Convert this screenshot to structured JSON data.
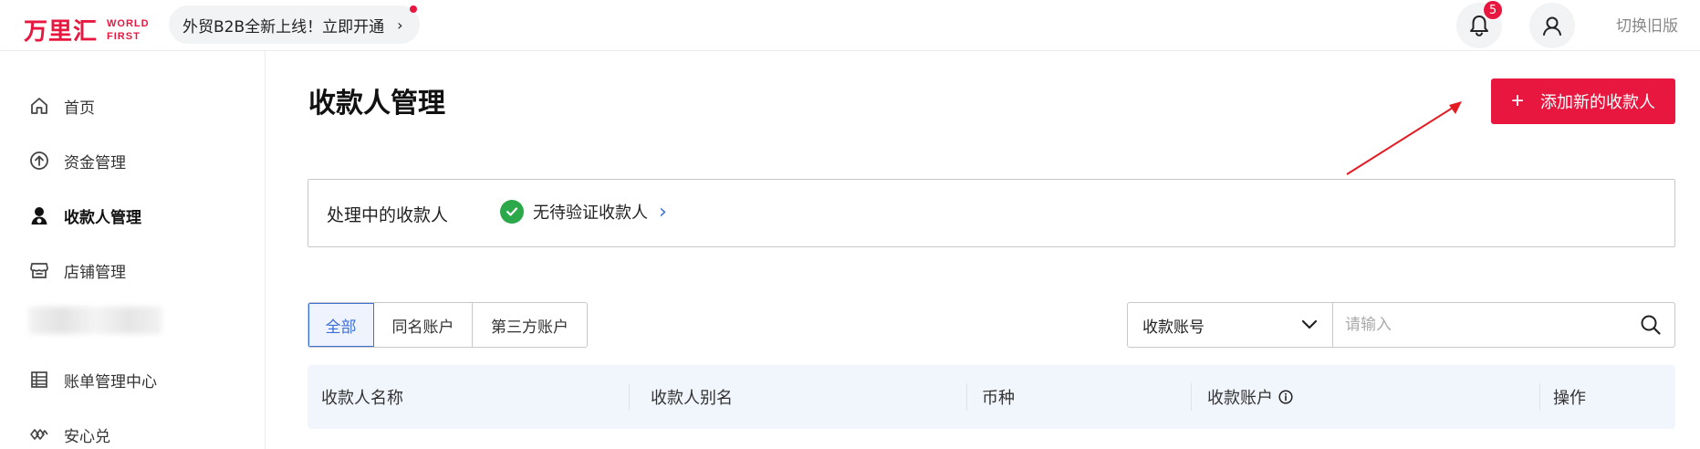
{
  "brand": {
    "logo_cn": "万里汇",
    "logo_en_line1": "WORLD",
    "logo_en_line2": "FIRST",
    "accent_color": "#e8173f"
  },
  "topbar": {
    "promo_text": "外贸B2B全新上线！立即开通",
    "notification_count": "5",
    "switch_old_label": "切换旧版"
  },
  "sidebar": {
    "items": [
      {
        "label": "首页",
        "icon": "home-icon"
      },
      {
        "label": "资金管理",
        "icon": "arrow-up-circle-icon"
      },
      {
        "label": "收款人管理",
        "icon": "payee-user-icon",
        "active": true
      },
      {
        "label": "店铺管理",
        "icon": "store-icon"
      },
      {
        "label": "",
        "icon": "blurred-item"
      },
      {
        "label": "账单管理中心",
        "icon": "bill-list-icon"
      },
      {
        "label": "安心兑",
        "icon": "exchange-icon"
      }
    ]
  },
  "main": {
    "page_title": "收款人管理",
    "add_button_label": "添加新的收款人",
    "processing": {
      "label": "处理中的收款人",
      "status_text": "无待验证收款人"
    },
    "tabs": [
      "全部",
      "同名账户",
      "第三方账户"
    ],
    "active_tab": "全部",
    "filter": {
      "select_value": "收款账号",
      "search_placeholder": "请输入"
    },
    "table": {
      "columns": [
        "收款人名称",
        "收款人别名",
        "币种",
        "收款账户",
        "操作"
      ]
    }
  }
}
